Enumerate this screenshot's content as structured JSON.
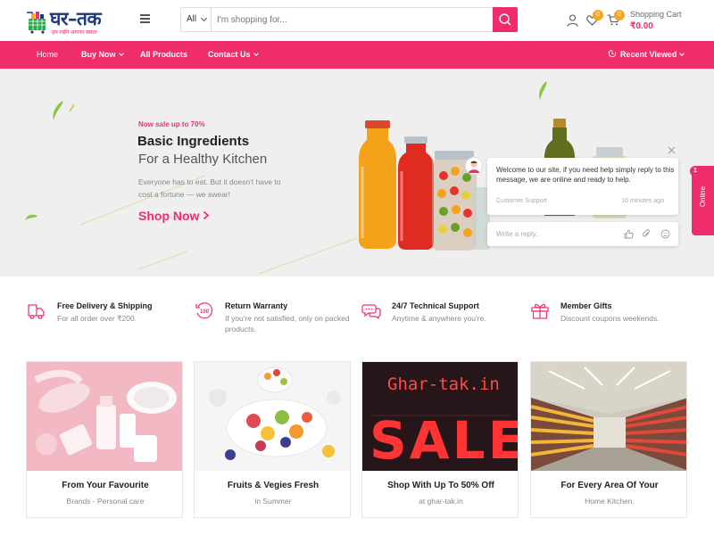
{
  "brand": {
    "logo_text": "घर–तक",
    "tagline": "हम रखेंगे आपका ख्याल",
    "primary_color": "#ef2d6b",
    "navy": "#1f3a7a"
  },
  "search": {
    "category": "All",
    "placeholder": "I'm shopping for..."
  },
  "header": {
    "wishlist_count": "0",
    "cart_count": "0",
    "cart_label": "Shopping Cart",
    "cart_total": "₹0.00"
  },
  "nav": {
    "home": "Home",
    "buy_now": "Buy Now",
    "all_products": "All Products",
    "contact_us": "Contact Us",
    "recent_viewed": "Recent Viewed"
  },
  "hero": {
    "sale": "Now sale up to 70%",
    "title": "Basic Ingredients",
    "subtitle": "For a Healthy Kitchen",
    "description": "Everyone has to eat. But it doesn't have to cost a fortune — we swear!",
    "cta": "Shop Now"
  },
  "chat": {
    "message": "Welcome to our site, if you need help simply reply to this message, we are online and ready to help.",
    "from": "Customer Support",
    "time": "10 minutes ago",
    "reply_placeholder": "Write a reply..",
    "tab_label": "Online",
    "tab_count": "1"
  },
  "features": [
    {
      "icon": "delivery-icon",
      "title": "Free Delivery & Shipping",
      "desc": "For all order over ₹200."
    },
    {
      "icon": "return-warranty-icon",
      "title": "Return Warranty",
      "desc": "If you're not satisfied, only on packed products."
    },
    {
      "icon": "support-chat-icon",
      "title": "24/7 Technical Support",
      "desc": "Anytime & anywhere you're."
    },
    {
      "icon": "gift-icon",
      "title": "Member Gifts",
      "desc": "Discount coupons weekends."
    }
  ],
  "cards": [
    {
      "title": "From Your Favourite",
      "sub": "Brands - Personal care"
    },
    {
      "title": "Fruits & Vegies Fresh",
      "sub": "in Summer"
    },
    {
      "title": "Shop With Up To 50% Off",
      "sub": "at ghar-tak.in",
      "sign_text": "Ghar-tak.in",
      "sale_text": "SALE"
    },
    {
      "title": "For Every Area Of Your",
      "sub": "Home Kitchen."
    }
  ]
}
